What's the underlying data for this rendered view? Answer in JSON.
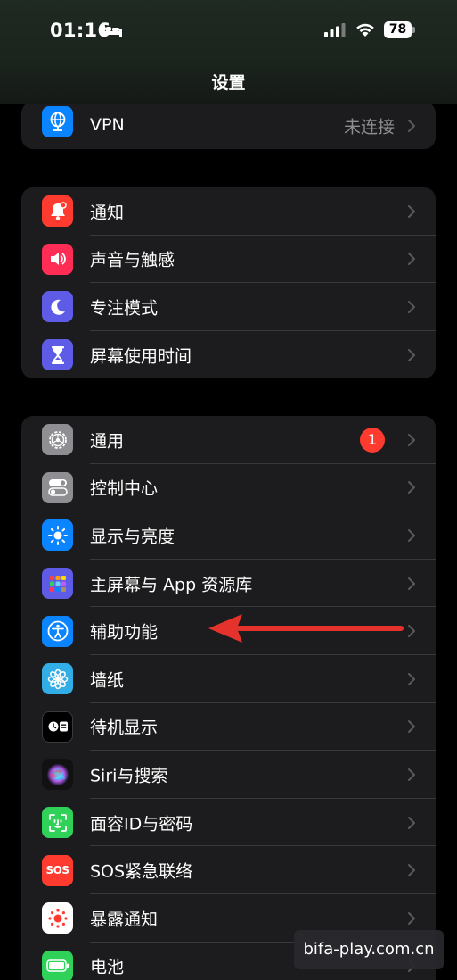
{
  "status_bar": {
    "time": "01:16",
    "battery": "78"
  },
  "nav": {
    "title": "设置"
  },
  "groups": [
    {
      "items": [
        {
          "label": "VPN",
          "value": "未连接",
          "icon": "vpn-globe-icon",
          "color": "#0a84ff"
        }
      ]
    },
    {
      "items": [
        {
          "label": "通知",
          "icon": "bell-icon",
          "color": "#ff3b30"
        },
        {
          "label": "声音与触感",
          "icon": "speaker-icon",
          "color": "#ff2d55"
        },
        {
          "label": "专注模式",
          "icon": "moon-icon",
          "color": "#5e5ce6"
        },
        {
          "label": "屏幕使用时间",
          "icon": "hourglass-icon",
          "color": "#5e5ce6"
        }
      ]
    },
    {
      "items": [
        {
          "label": "通用",
          "icon": "gear-icon",
          "color": "#8e8e93",
          "badge": "1"
        },
        {
          "label": "控制中心",
          "icon": "toggles-icon",
          "color": "#8e8e93"
        },
        {
          "label": "显示与亮度",
          "icon": "sun-icon",
          "color": "#0a84ff"
        },
        {
          "label": "主屏幕与 App 资源库",
          "icon": "app-grid-icon",
          "color": "#5e5ce6"
        },
        {
          "label": "辅助功能",
          "icon": "accessibility-icon",
          "color": "#0a84ff"
        },
        {
          "label": "墙纸",
          "icon": "flower-icon",
          "color": "#32ade6"
        },
        {
          "label": "待机显示",
          "icon": "standby-icon",
          "color": "#000000"
        },
        {
          "label": "Siri与搜索",
          "icon": "siri-icon",
          "color": "#1c1c1e"
        },
        {
          "label": "面容ID与密码",
          "icon": "face-id-icon",
          "color": "#30d158"
        },
        {
          "label": "SOS紧急联络",
          "icon": "sos-icon",
          "color": "#ff3b30"
        },
        {
          "label": "暴露通知",
          "icon": "exposure-icon",
          "color": "#ffffff"
        },
        {
          "label": "电池",
          "icon": "battery-icon",
          "color": "#30d158"
        }
      ]
    }
  ],
  "icons": {
    "sos_text": "SOS"
  },
  "watermark": "bifa-play.com.cn",
  "colors": {
    "accent_arrow": "#e5322d",
    "background": "#000000",
    "cell": "#1c1c1e"
  }
}
